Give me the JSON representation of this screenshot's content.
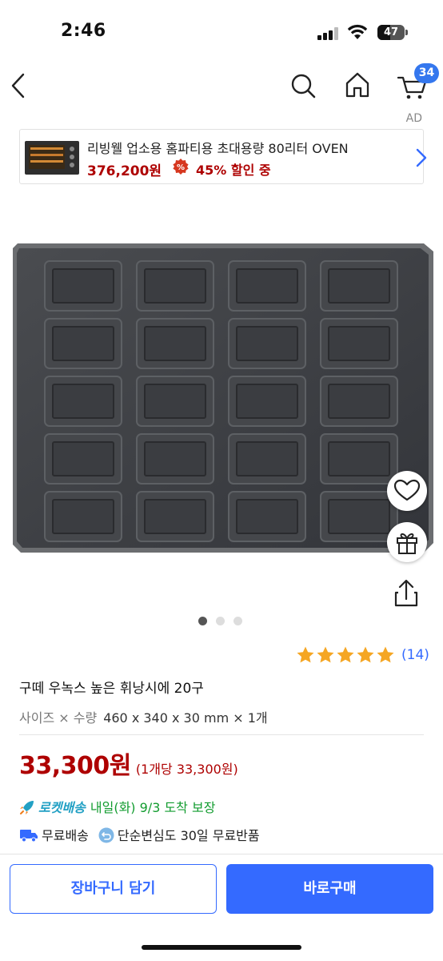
{
  "status_bar": {
    "time": "2:46",
    "battery": "47",
    "battery_level_percent": 47
  },
  "nav": {
    "back_icon": "chevron-left-icon",
    "search_icon": "search-icon",
    "home_icon": "home-icon",
    "cart_icon": "cart-icon",
    "cart_count": "34"
  },
  "ad": {
    "label": "AD",
    "title": "리빙웰 업소용 홈파티용 초대용량 80리터 OVEN",
    "price": "376,200원",
    "discount": "45% 할인 중",
    "coupon_icon": "coupon-badge-icon"
  },
  "gallery": {
    "image_count": 3,
    "active_index": 0,
    "heart_icon": "heart-icon",
    "gift_icon": "gift-icon",
    "share_icon": "share-icon"
  },
  "rating": {
    "stars": 5,
    "review_count": "(14)"
  },
  "product": {
    "title": "구떼 우녹스 높은 휘낭시에 20구",
    "option_label": "사이즈 × 수량",
    "option_value": "460 x 340 x 30 mm × 1개",
    "price": "33,300원",
    "unit_price": "(1개당 33,300원)"
  },
  "delivery": {
    "rocket_label": "로켓배송",
    "arrival": "내일(화) 9/3 도착 보장",
    "free_shipping": "무료배송",
    "free_return": "단순변심도 30일 무료반품"
  },
  "actions": {
    "add_to_cart": "장바구니 담기",
    "buy_now": "바로구매"
  },
  "colors": {
    "accent": "#346aff",
    "price": "#ae0000",
    "rocket": "#22a0c4",
    "arrival": "#129c2f"
  }
}
